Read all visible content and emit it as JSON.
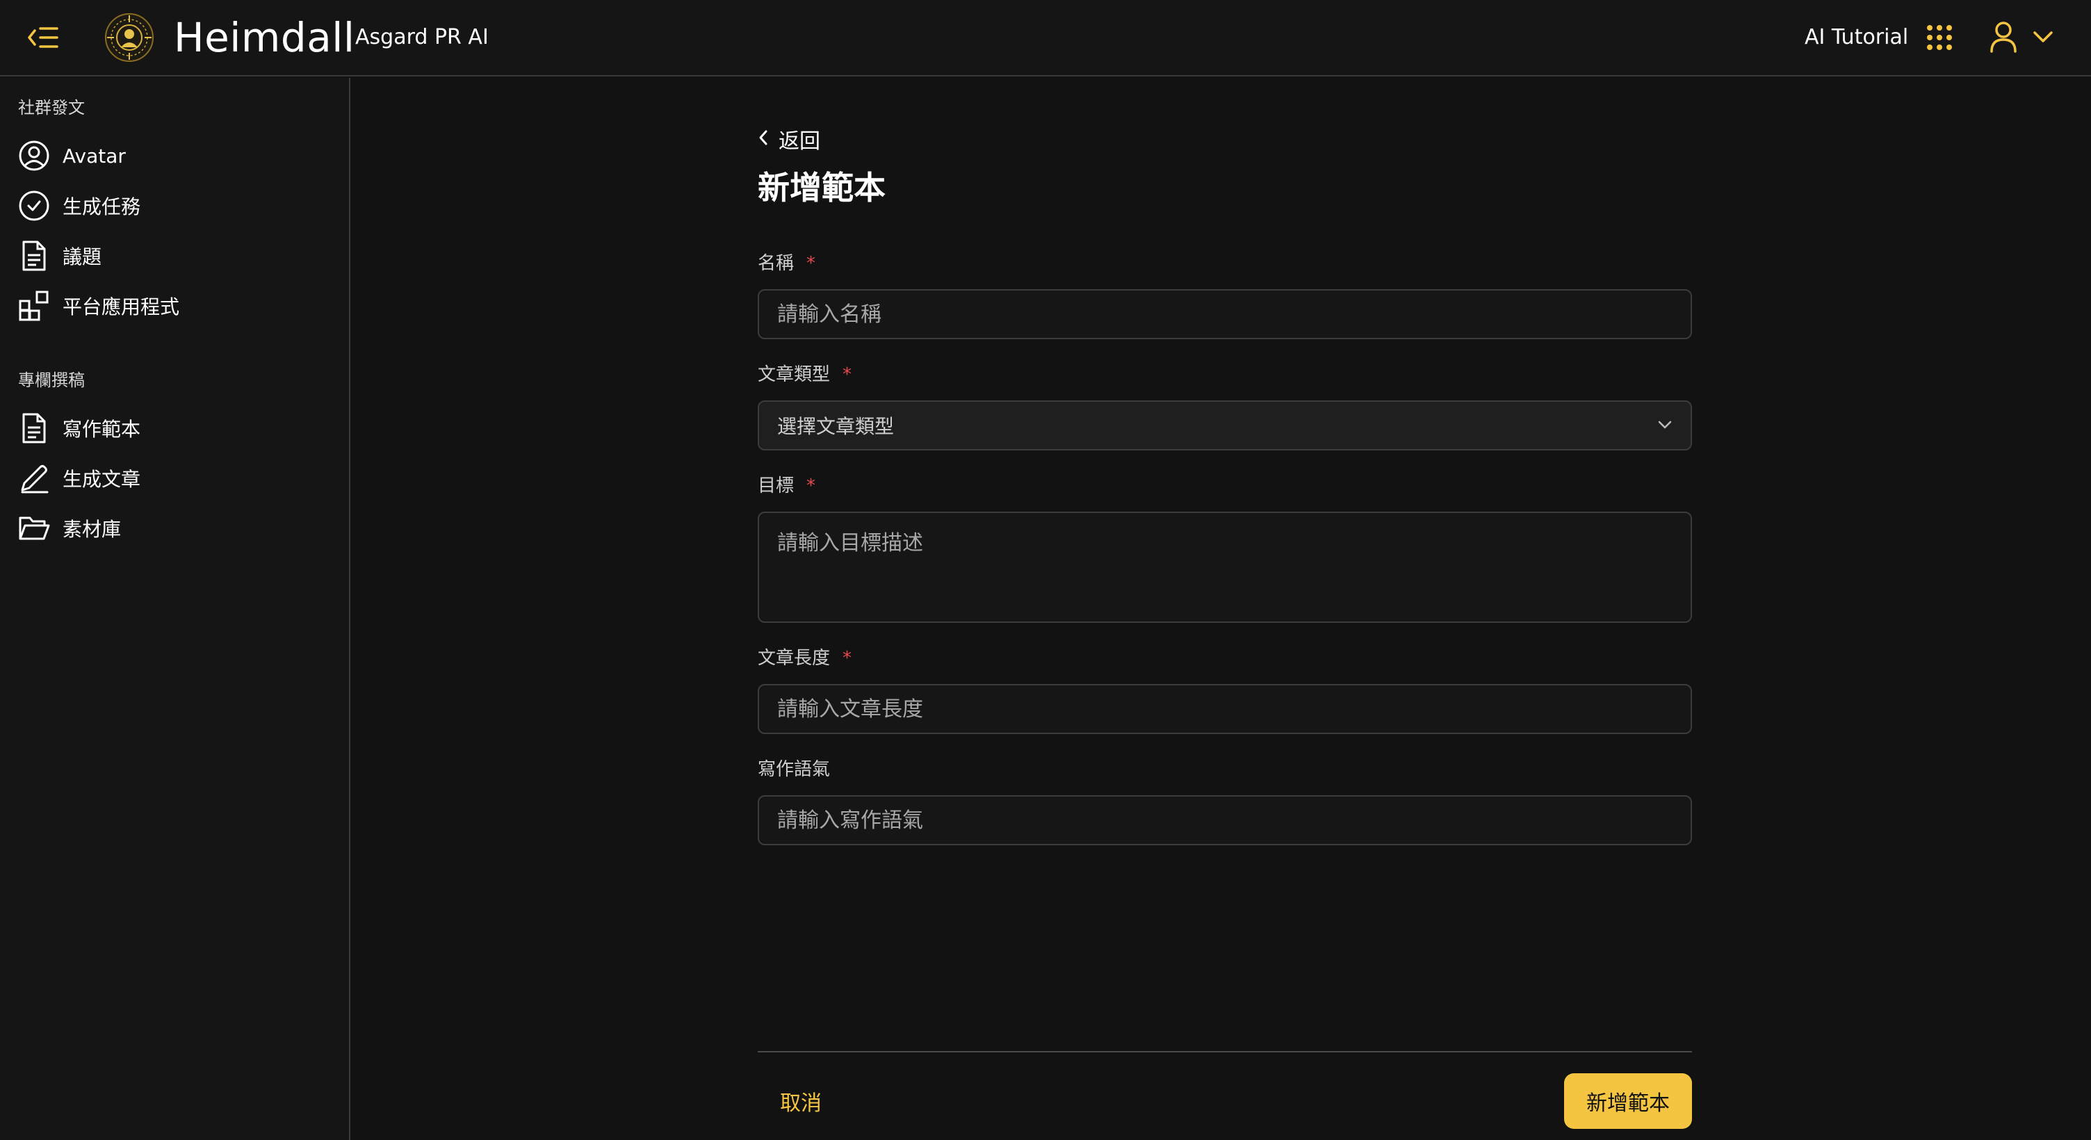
{
  "header": {
    "brand": "Heimdall",
    "subtitle": "Asgard PR AI",
    "tutorial_label": "AI Tutorial",
    "icons": {
      "menu": "collapse-menu-icon",
      "logo": "heimdall-logo-icon",
      "apps": "grid-apps-icon",
      "user": "user-icon",
      "dropdown": "chevron-down-icon"
    }
  },
  "sidebar": {
    "sections": [
      {
        "title": "社群發文",
        "items": [
          {
            "label": "Avatar",
            "icon": "user-circle-icon"
          },
          {
            "label": "生成任務",
            "icon": "check-circle-icon"
          },
          {
            "label": "議題",
            "icon": "document-icon"
          },
          {
            "label": "平台應用程式",
            "icon": "apps-blocks-icon"
          }
        ]
      },
      {
        "title": "專欄撰稿",
        "items": [
          {
            "label": "寫作範本",
            "icon": "document-icon"
          },
          {
            "label": "生成文章",
            "icon": "pen-icon"
          },
          {
            "label": "素材庫",
            "icon": "folder-open-icon"
          }
        ]
      }
    ]
  },
  "form": {
    "back_label": "返回",
    "title": "新增範本",
    "required_mark": "*",
    "fields": {
      "name": {
        "label": "名稱",
        "placeholder": "請輸入名稱",
        "value": ""
      },
      "article_type": {
        "label": "文章類型",
        "placeholder": "選擇文章類型"
      },
      "goal": {
        "label": "目標",
        "placeholder": "請輸入目標描述",
        "value": ""
      },
      "length": {
        "label": "文章長度",
        "placeholder": "請輸入文章長度",
        "value": ""
      },
      "tone": {
        "label": "寫作語氣",
        "placeholder": "請輸入寫作語氣",
        "value": ""
      }
    },
    "cancel_label": "取消",
    "submit_label": "新增範本"
  },
  "colors": {
    "accent": "#f5c542",
    "required": "#e5484d",
    "background": "#121212",
    "border": "#3c3c3c"
  }
}
